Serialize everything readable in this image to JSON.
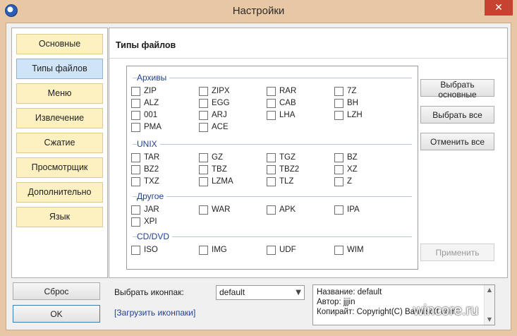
{
  "window": {
    "title": "Настройки",
    "close_glyph": "✕"
  },
  "nav": {
    "items": [
      "Основные",
      "Типы файлов",
      "Меню",
      "Извлечение",
      "Сжатие",
      "Просмотрщик",
      "Дополнительно",
      "Язык"
    ],
    "active_index": 1
  },
  "buttons": {
    "reset": "Сброс",
    "ok": "OK"
  },
  "content": {
    "title": "Типы файлов",
    "groups": [
      {
        "name": "Архивы",
        "types": [
          "ZIP",
          "ZIPX",
          "RAR",
          "7Z",
          "ALZ",
          "EGG",
          "CAB",
          "BH",
          "001",
          "ARJ",
          "LHA",
          "LZH",
          "PMA",
          "ACE"
        ]
      },
      {
        "name": "UNIX",
        "types": [
          "TAR",
          "GZ",
          "TGZ",
          "BZ",
          "BZ2",
          "TBZ",
          "TBZ2",
          "XZ",
          "TXZ",
          "LZMA",
          "TLZ",
          "Z"
        ]
      },
      {
        "name": "Другое",
        "types": [
          "JAR",
          "WAR",
          "APK",
          "IPA",
          "XPI"
        ]
      },
      {
        "name": "CD/DVD",
        "types": [
          "ISO",
          "IMG",
          "UDF",
          "WIM"
        ]
      }
    ],
    "side_buttons": {
      "select_main": "Выбрать основные",
      "select_all": "Выбрать все",
      "deselect_all": "Отменить все",
      "apply": "Применить"
    }
  },
  "iconpack": {
    "label": "Выбрать иконпак:",
    "selected": "default",
    "load_link": "[Загрузить иконпаки]",
    "info": [
      "Название: default",
      "Автор: jjjin",
      "Копирайт: Copyright(C) Bandisoft.com"
    ]
  },
  "watermark": "wincore.ru",
  "colors": {
    "frame": "#e8c8a4",
    "close": "#c8432f",
    "nav_item": "#fdf1c2",
    "nav_active": "#cfe4f7",
    "group_label": "#1f3f8f"
  }
}
